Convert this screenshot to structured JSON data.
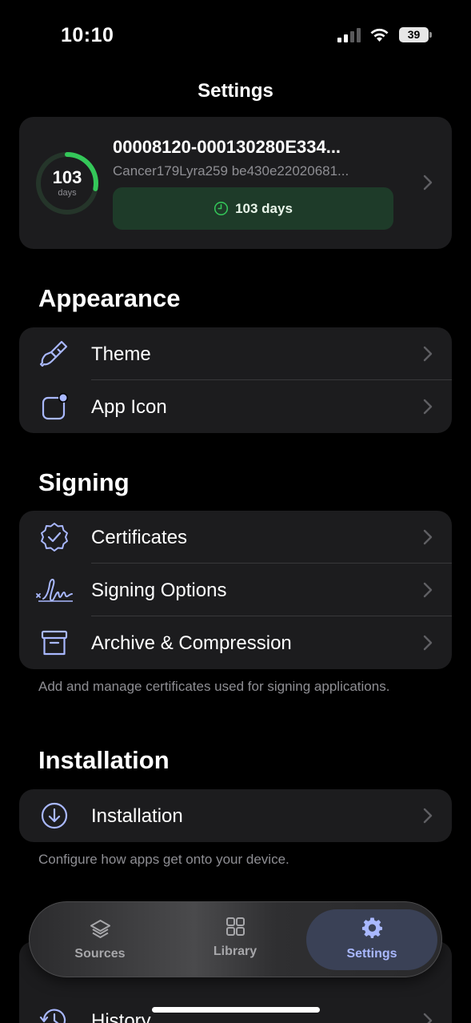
{
  "status_bar": {
    "time": "10:10",
    "battery_level": "39"
  },
  "nav": {
    "title": "Settings"
  },
  "certificate": {
    "days_remaining": "103",
    "days_unit": "days",
    "ring_fill_fraction": 0.28,
    "name": "00008120-000130280E334...",
    "subtitle": "Cancer179Lyra259 be430e22020681...",
    "expiry_pill": "103 days"
  },
  "sections": {
    "appearance": {
      "title": "Appearance",
      "items": [
        {
          "label": "Theme",
          "icon": "paintbrush-icon"
        },
        {
          "label": "App Icon",
          "icon": "app-icon-badge-icon"
        }
      ]
    },
    "signing": {
      "title": "Signing",
      "items": [
        {
          "label": "Certificates",
          "icon": "checkmark-seal-icon"
        },
        {
          "label": "Signing Options",
          "icon": "signature-icon"
        },
        {
          "label": "Archive & Compression",
          "icon": "archive-box-icon"
        }
      ],
      "footer": "Add and manage certificates used for signing applications."
    },
    "installation": {
      "title": "Installation",
      "items": [
        {
          "label": "Installation",
          "icon": "arrow-down-circle-icon"
        }
      ],
      "footer": "Configure how apps get onto your device."
    },
    "partial": {
      "items": [
        {
          "label": "History",
          "icon": "history-clock-icon"
        }
      ]
    }
  },
  "tab_bar": {
    "tabs": [
      {
        "label": "Sources",
        "icon": "stack-layers-icon"
      },
      {
        "label": "Library",
        "icon": "grid-squares-icon"
      },
      {
        "label": "Settings",
        "icon": "gear-icon",
        "active": true
      }
    ]
  },
  "colors": {
    "accent": "#a9b8ff",
    "ring_green": "#34c759",
    "pill_bg": "#1e3b29",
    "card_bg": "#1c1c1e"
  }
}
